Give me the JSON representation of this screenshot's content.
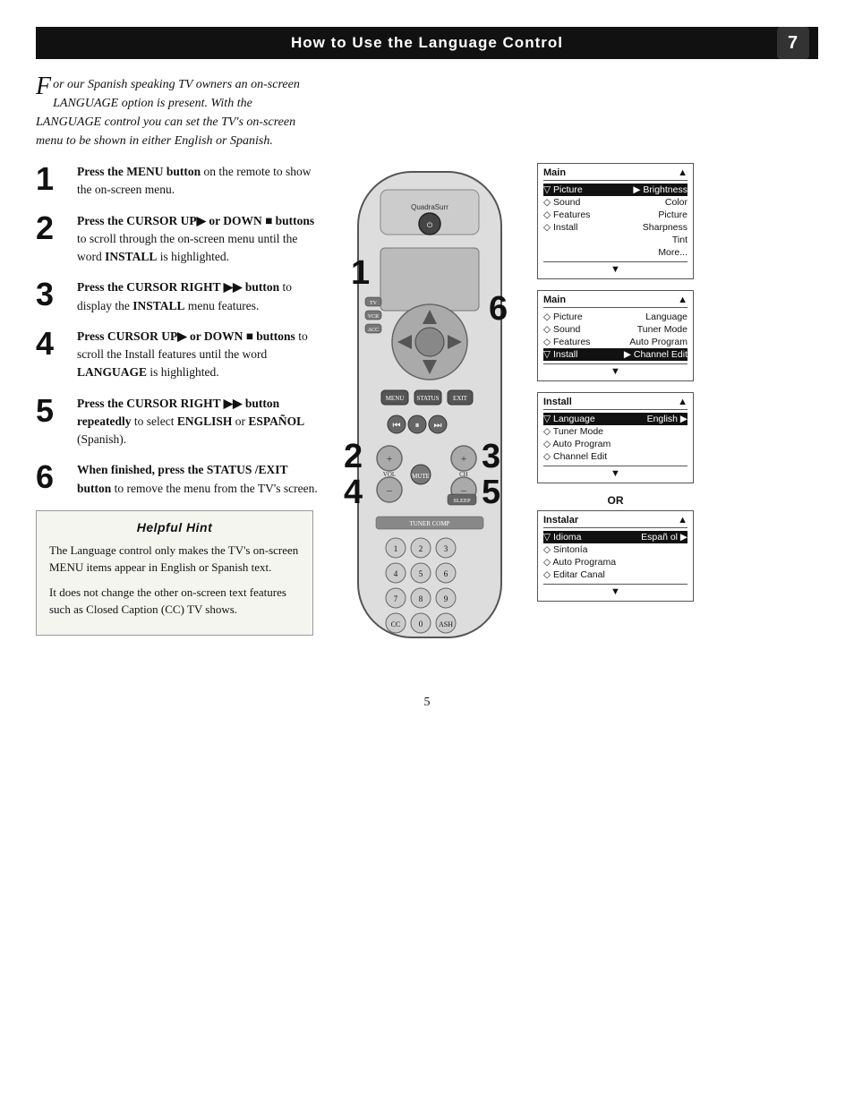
{
  "header": {
    "title": "How to Use the Language Control",
    "icon": "7"
  },
  "intro": {
    "drop_cap": "F",
    "text": "or our Spanish speaking TV owners an on-screen LANGUAGE option is present. With the LANGUAGE control you can set the TV's on-screen menu to be shown in either English or Spanish."
  },
  "steps": [
    {
      "num": "1",
      "bold": "Press the MENU button",
      "rest": " on the remote to show the on-screen menu."
    },
    {
      "num": "2",
      "bold": "Press the CURSOR UP▶ or DOWN ■ buttons",
      "rest": " to scroll through the on-screen menu until the word INSTALL is highlighted."
    },
    {
      "num": "3",
      "bold": "Press the CURSOR RIGHT ▶▶ button",
      "rest": " to display the INSTALL menu features."
    },
    {
      "num": "4",
      "bold": "Press CURSOR UP▶ or DOWN ■ buttons",
      "rest": " to scroll the Install features until the word LANGUAGE is highlighted."
    },
    {
      "num": "5",
      "bold": "Press the CURSOR RIGHT ▶▶ button repeatedly",
      "rest": " to select ENGLISH or ESPAÑOL (Spanish)."
    },
    {
      "num": "6",
      "bold": "When finished, press the STATUS /EXIT button",
      "rest": " to remove the menu from the TV's screen."
    }
  ],
  "hint": {
    "title": "Helpful Hint",
    "paragraphs": [
      "The Language control only makes the TV's on-screen MENU items appear in English or Spanish text.",
      "It does not change the other on-screen text features such as Closed Caption (CC) TV shows."
    ]
  },
  "screens": {
    "screen1": {
      "title": "Main",
      "arrow": "▲",
      "rows": [
        {
          "left": "▽ Picture",
          "mid": "▶",
          "right": "Brightness",
          "highlight": false
        },
        {
          "left": "◇ Sound",
          "mid": "",
          "right": "Color",
          "highlight": false
        },
        {
          "left": "◇ Features",
          "mid": "",
          "right": "Picture",
          "highlight": false
        },
        {
          "left": "◇ Install",
          "mid": "",
          "right": "Sharpness",
          "highlight": false
        },
        {
          "left": "",
          "mid": "",
          "right": "Tint",
          "highlight": false
        },
        {
          "left": "",
          "mid": "",
          "right": "More...",
          "highlight": false
        }
      ],
      "footer": "▼"
    },
    "screen2": {
      "title": "Main",
      "arrow": "▲",
      "rows": [
        {
          "left": "◇ Picture",
          "mid": "",
          "right": "Language",
          "highlight": false
        },
        {
          "left": "◇ Sound",
          "mid": "",
          "right": "Tuner Mode",
          "highlight": false
        },
        {
          "left": "◇ Features",
          "mid": "",
          "right": "Auto Program",
          "highlight": false
        },
        {
          "left": "▽ Install",
          "mid": "▶",
          "right": "Channel Edit",
          "highlight": true
        }
      ],
      "footer": "▼"
    },
    "screen3": {
      "title": "Install",
      "arrow": "▲",
      "rows": [
        {
          "left": "▽ Language",
          "mid": "",
          "right": "English ▶",
          "highlight": true
        },
        {
          "left": "◇ Tuner Mode",
          "mid": "",
          "right": "",
          "highlight": false
        },
        {
          "left": "◇ Auto Program",
          "mid": "",
          "right": "",
          "highlight": false
        },
        {
          "left": "◇ Channel Edit",
          "mid": "",
          "right": "",
          "highlight": false
        }
      ],
      "footer": "▼"
    },
    "or_label": "OR",
    "screen4": {
      "title": "Instalar",
      "arrow": "▲",
      "rows": [
        {
          "left": "▽ Idioma",
          "mid": "",
          "right": "Españ ol ▶",
          "highlight": true
        },
        {
          "left": "◇ Sintonía",
          "mid": "",
          "right": "",
          "highlight": false
        },
        {
          "left": "◇ Auto Programa",
          "mid": "",
          "right": "",
          "highlight": false
        },
        {
          "left": "◇ Editar Canal",
          "mid": "",
          "right": "",
          "highlight": false
        }
      ],
      "footer": "▼"
    }
  },
  "step_labels_on_remote": [
    "1",
    "2",
    "4",
    "2",
    "4",
    "3",
    "5",
    "6"
  ],
  "page_number": "5"
}
